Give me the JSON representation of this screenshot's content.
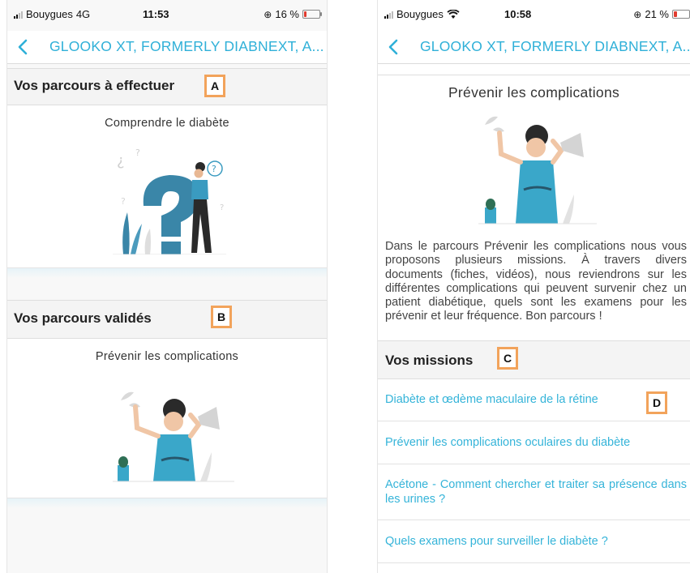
{
  "colors": {
    "accent": "#2fb0d8",
    "mission_link": "#35b4d9",
    "badge_border": "#f2a35b",
    "battery_low": "#e03b2f"
  },
  "left_screen": {
    "status": {
      "carrier": "Bouygues",
      "network": "4G",
      "time": "11:53",
      "battery": "16 %",
      "battery_level": 0.16
    },
    "nav": {
      "back_icon": "chevron-left-icon",
      "title": "GLOOKO XT, FORMERLY DIABNEXT, A..."
    },
    "sections": [
      {
        "heading": "Vos parcours à effectuer",
        "badge": "A",
        "card_title": "Comprendre le diabète",
        "illustration": "question-mark-person-illustration"
      },
      {
        "heading": "Vos parcours validés",
        "badge": "B",
        "card_title": "Prévenir les complications",
        "illustration": "woman-megaphone-illustration"
      }
    ]
  },
  "right_screen": {
    "status": {
      "carrier": "Bouygues",
      "network_icon": "wifi-icon",
      "time": "10:58",
      "battery": "21 %",
      "battery_level": 0.21
    },
    "nav": {
      "back_icon": "chevron-left-icon",
      "title": "GLOOKO XT, FORMERLY DIABNEXT, A..."
    },
    "course": {
      "title": "Prévenir les complications",
      "illustration": "woman-megaphone-illustration",
      "description": "Dans le parcours Prévenir les complications nous vous proposons plusieurs missions. À travers divers documents (fiches, vidéos), nous reviendrons sur les différentes complications qui peuvent survenir chez un patient diabétique, quels sont les examens pour les prévenir et leur fréquence. Bon parcours !"
    },
    "missions_heading": "Vos missions",
    "missions_badge": "C",
    "missions": [
      {
        "label": "Diabète et œdème maculaire de la rétine",
        "badge": "D"
      },
      {
        "label": "Prévenir les complications oculaires du diabète"
      },
      {
        "label": "Acétone - Comment chercher et traiter sa présence dans les urines ?"
      },
      {
        "label": "Quels examens pour surveiller le diabète ?"
      }
    ]
  }
}
